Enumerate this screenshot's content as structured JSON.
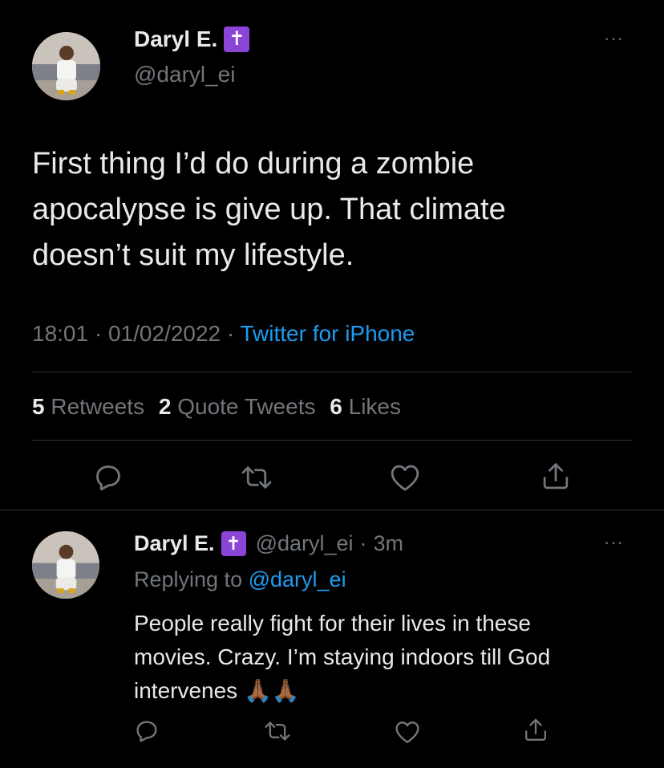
{
  "tweet": {
    "author_name": "Daryl E.",
    "badge": "✝",
    "handle": "@daryl_ei",
    "more": "···",
    "text_lines": [
      "First thing I’d do during a zombie",
      "apocalypse is give up. That climate",
      "doesn’t suit my lifestyle."
    ],
    "time": "18:01",
    "sep": "·",
    "date": "01/02/2022",
    "source": "Twitter for iPhone",
    "stats": {
      "retweets_count": "5",
      "retweets_label": "Retweets",
      "quotes_count": "2",
      "quotes_label": "Quote Tweets",
      "likes_count": "6",
      "likes_label": "Likes"
    },
    "actions": [
      "reply-icon",
      "retweet-icon",
      "like-icon",
      "share-icon"
    ]
  },
  "reply": {
    "author_name": "Daryl E.",
    "badge": "✝",
    "handle": "@daryl_ei",
    "sep": "·",
    "age": "3m",
    "more": "···",
    "replying_prefix": "Replying to",
    "replying_to": "@daryl_ei",
    "text_lines": [
      "People really fight for their lives in these",
      "movies. Crazy. I’m staying indoors till God",
      "intervenes"
    ],
    "emoji": "🙏🏾🙏🏾",
    "actions": [
      "reply-icon",
      "retweet-icon",
      "like-icon",
      "share-icon"
    ]
  },
  "colors": {
    "background": "#000000",
    "text": "#e7e9ea",
    "muted": "#71767b",
    "link": "#1d9bf0",
    "badge": "#8a44d6",
    "divider": "#2f3336"
  }
}
